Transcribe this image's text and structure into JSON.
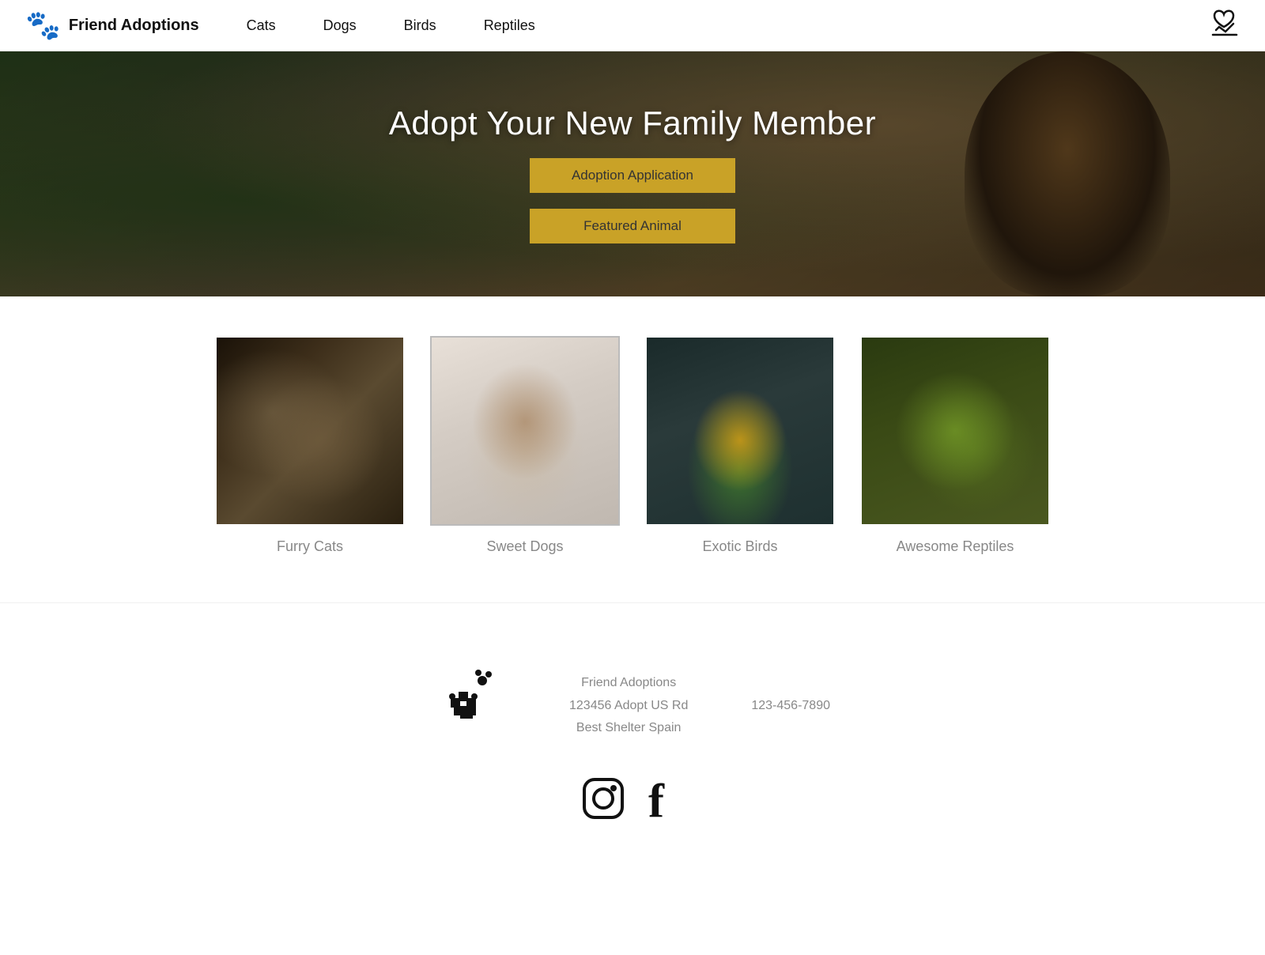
{
  "header": {
    "logo_icon": "🐾",
    "logo_text": "Friend Adoptions",
    "nav": [
      {
        "label": "Cats",
        "href": "#"
      },
      {
        "label": "Dogs",
        "href": "#"
      },
      {
        "label": "Birds",
        "href": "#"
      },
      {
        "label": "Reptiles",
        "href": "#"
      }
    ],
    "donate_icon": "donate-icon"
  },
  "hero": {
    "title": "Adopt Your New Family Member",
    "btn_application": "Adoption Application",
    "btn_featured": "Featured Animal"
  },
  "animals": [
    {
      "label": "Furry Cats",
      "type": "cat"
    },
    {
      "label": "Sweet Dogs",
      "type": "dog"
    },
    {
      "label": "Exotic Birds",
      "type": "bird"
    },
    {
      "label": "Awesome Reptiles",
      "type": "reptile"
    }
  ],
  "footer": {
    "logo_icon": "🐾",
    "address_line1": "Friend Adoptions",
    "address_line2": "123456 Adopt US Rd",
    "address_line3": "Best Shelter Spain",
    "phone": "123-456-7890",
    "social": [
      {
        "name": "Instagram",
        "icon": "instagram"
      },
      {
        "name": "Facebook",
        "icon": "facebook"
      }
    ]
  }
}
